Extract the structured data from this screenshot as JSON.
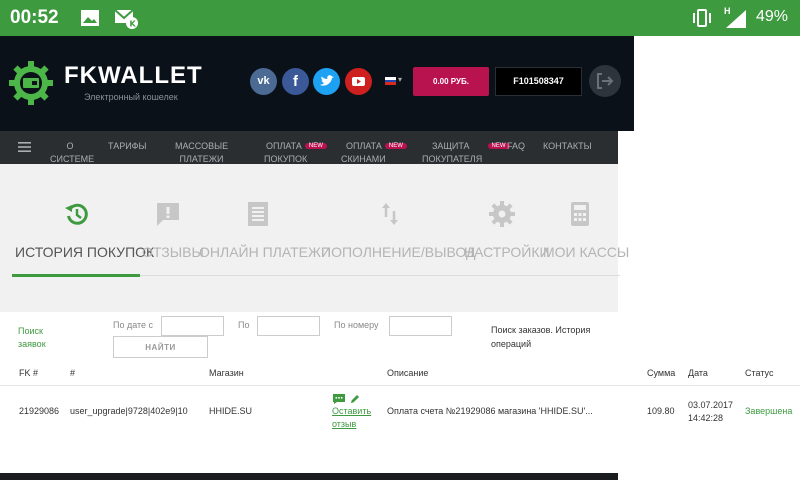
{
  "status_bar": {
    "time": "00:52",
    "network": "H",
    "battery": "49%"
  },
  "header": {
    "logo_title": "FKWALLET",
    "logo_subtitle": "Электронный кошелек",
    "social": [
      "vk-icon",
      "facebook-icon",
      "twitter-icon",
      "youtube-icon"
    ],
    "balance": "0.00 РУБ.",
    "wallet_id": "F101508347"
  },
  "nav": {
    "items": [
      {
        "line1": "О",
        "line2": "СИСТЕМЕ"
      },
      {
        "line1": "ТАРИФЫ",
        "line2": ""
      },
      {
        "line1": "МАССОВЫЕ",
        "line2": "ПЛАТЕЖИ"
      },
      {
        "line1": "ОПЛАТА",
        "line2": "ПОКУПОК",
        "badge": "NEW"
      },
      {
        "line1": "ОПЛАТА",
        "line2": "СКИНАМИ",
        "badge": "NEW"
      },
      {
        "line1": "ЗАЩИТА",
        "line2": "ПОКУПАТЕЛЯ",
        "badge": "NEW"
      },
      {
        "line1": "FAQ",
        "line2": ""
      },
      {
        "line1": "КОНТАКТЫ",
        "line2": ""
      }
    ]
  },
  "tabs": [
    {
      "label": "ИСТОРИЯ ПОКУПОК",
      "icon": "history-icon",
      "active": true
    },
    {
      "label": "ОТЗЫВЫ",
      "icon": "review-icon"
    },
    {
      "label": "ОНЛАЙН ПЛАТЕЖИ",
      "icon": "receipt-icon"
    },
    {
      "label": "ПОПОЛНЕНИЕ/ВЫВОД",
      "icon": "transfer-icon"
    },
    {
      "label": "НАСТРОЙКИ",
      "icon": "gear-icon"
    },
    {
      "label": "МОИ КАССЫ",
      "icon": "calculator-icon"
    }
  ],
  "filters": {
    "search_label_1": "Поиск",
    "search_label_2": "заявок",
    "date_from_label": "По дате с",
    "date_to_label": "По",
    "number_label": "По номеру",
    "find_button": "НАЙТИ",
    "description_1": "Поиск заказов. История",
    "description_2": "операций"
  },
  "table": {
    "columns": [
      "FK #",
      "#",
      "Магазин",
      "Описание",
      "Сумма",
      "Дата",
      "Статус"
    ],
    "rows": [
      {
        "fk": "21929086",
        "id": "user_upgrade|9728|402e9|10",
        "shop": "HHIDE.SU",
        "review_1": "Оставить",
        "review_2": "отзыв",
        "description": "Оплата счета №21929086 магазина 'HHIDE.SU'...",
        "amount": "109.80",
        "date": "03.07.2017",
        "time": "14:42:28",
        "status": "Завершена"
      }
    ]
  }
}
